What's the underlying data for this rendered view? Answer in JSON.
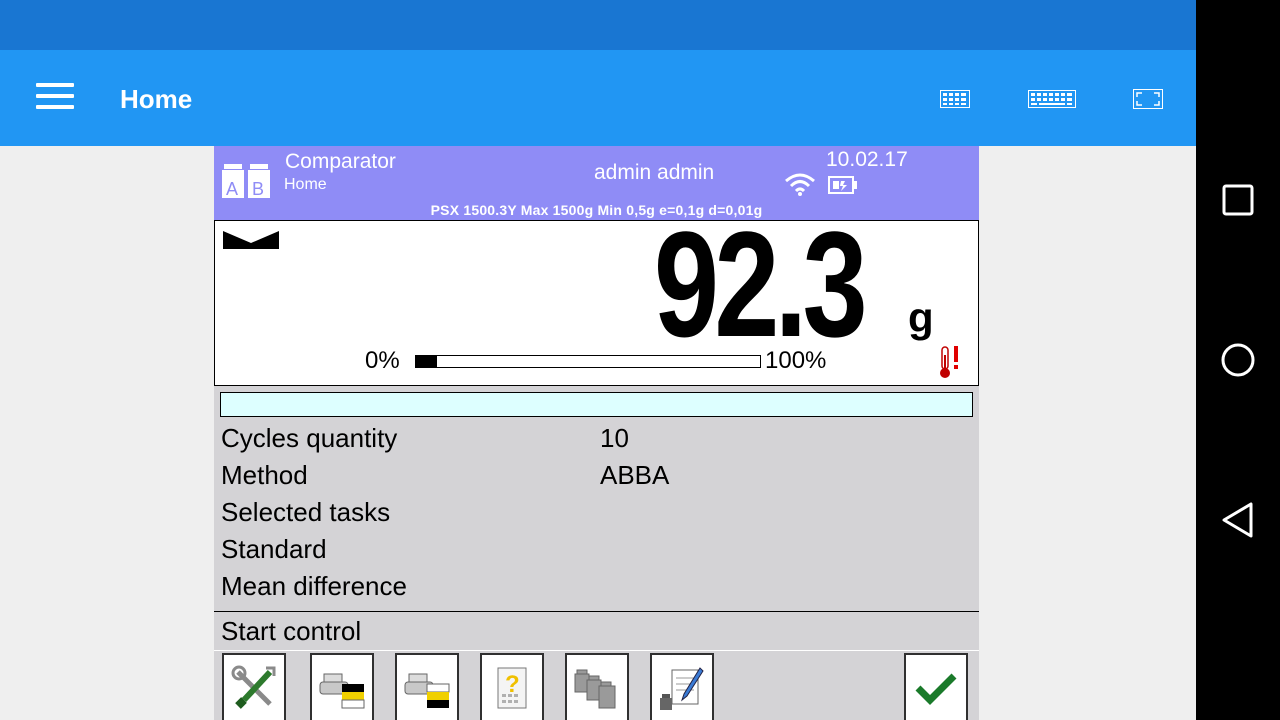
{
  "appbar": {
    "title": "Home"
  },
  "terminal": {
    "header": {
      "mode_title": "Comparator",
      "mode_subtitle": "Home",
      "user": "admin admin",
      "date": "10.02.17",
      "metrology": "PSX 1500.3Y  Max 1500g  Min 0,5g  e=0,1g  d=0,01g",
      "colors": {
        "header_bg": "#8f8cf6"
      }
    },
    "display": {
      "value": "92.3",
      "unit": "g",
      "bar_start_label": "0%",
      "bar_end_label": "100%",
      "bar_fill_fraction": 0.06
    },
    "params": [
      {
        "label": "Cycles quantity",
        "value": "10"
      },
      {
        "label": "Method",
        "value": "ABBA"
      },
      {
        "label": "Selected tasks",
        "value": ""
      },
      {
        "label": "Standard",
        "value": ""
      },
      {
        "label": "Mean difference",
        "value": ""
      }
    ],
    "start_control": "Start control",
    "function_buttons": [
      "settings-tools-icon",
      "print-header-icon",
      "print-footer-icon",
      "help-icon",
      "weights-icon",
      "weight-edit-icon",
      "confirm-check-icon"
    ]
  }
}
